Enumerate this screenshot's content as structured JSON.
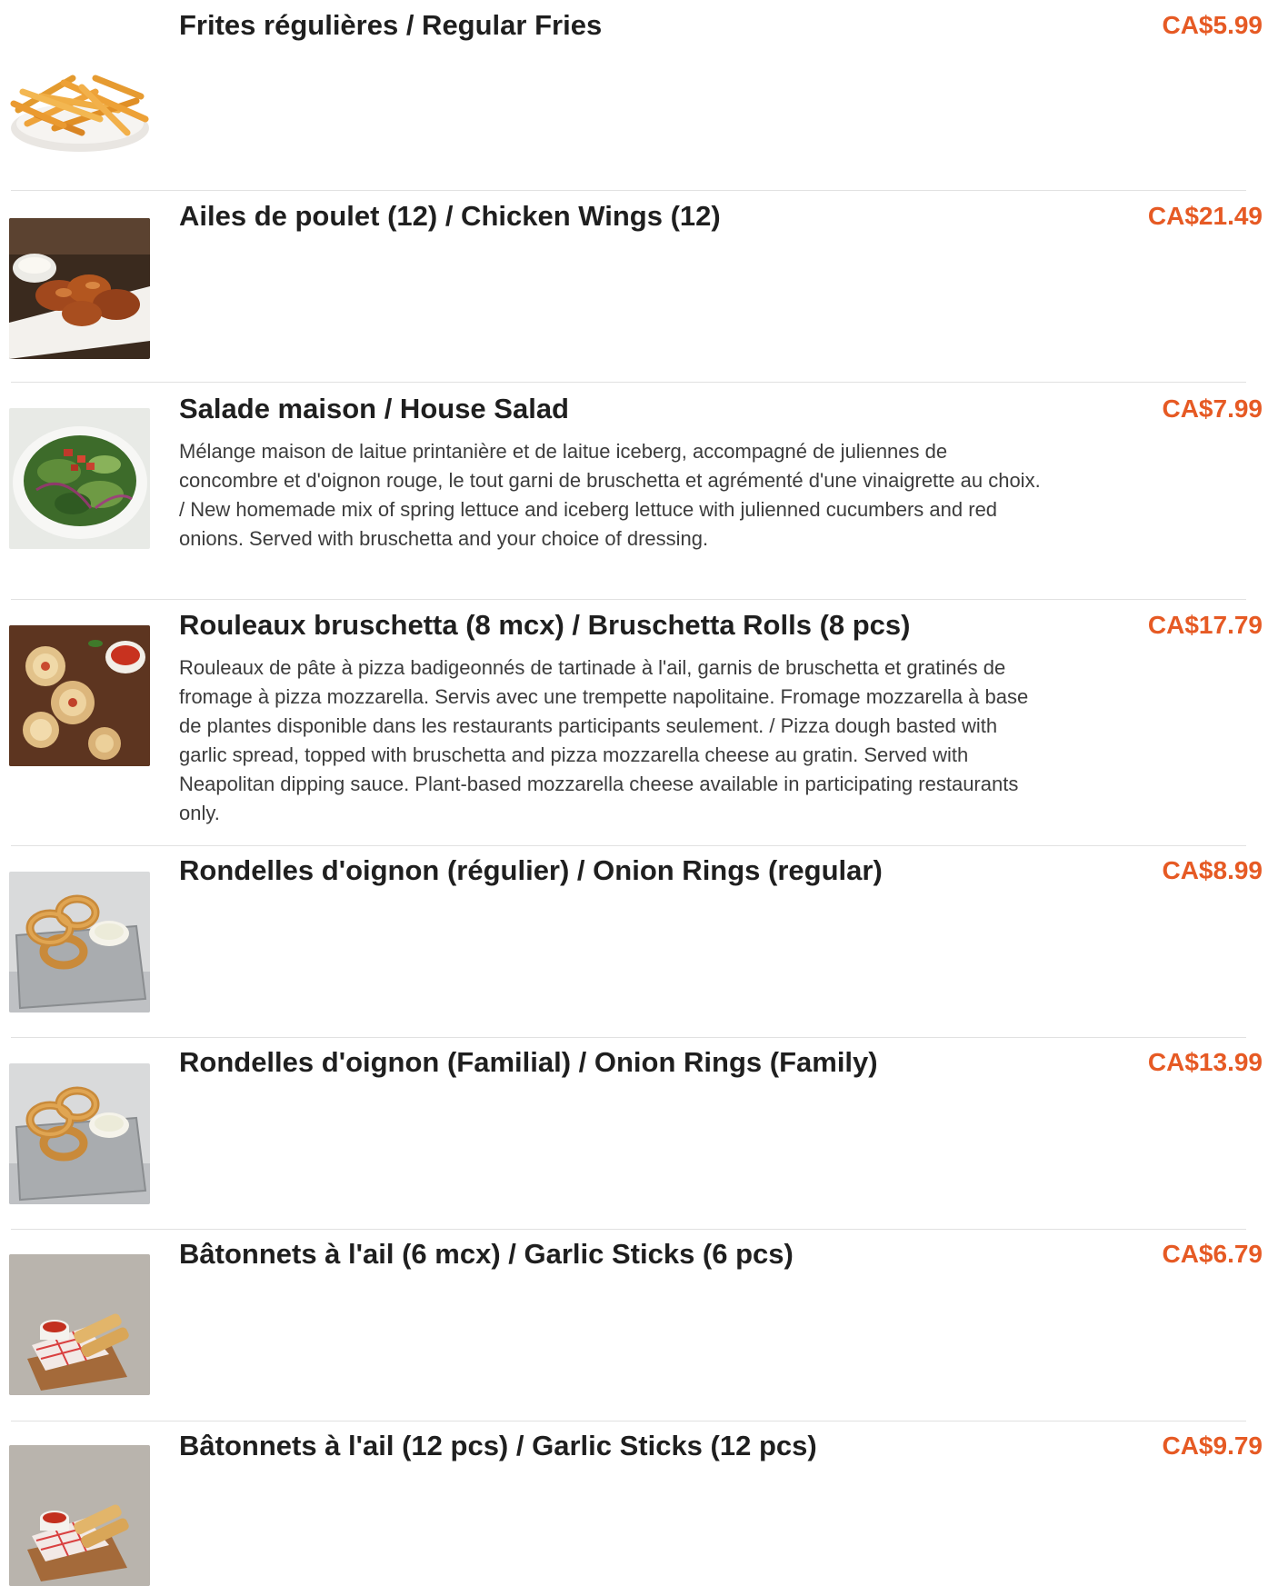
{
  "colors": {
    "price": "#e65a24",
    "title": "#1f1f1f",
    "description": "#3c3c3c",
    "divider": "#e1e1e1"
  },
  "items": [
    {
      "name": "Frites régulières / Regular Fries",
      "price": "CA$5.99",
      "description": "",
      "image": "fries-photo"
    },
    {
      "name": "Ailes de poulet (12) / Chicken Wings (12)",
      "price": "CA$21.49",
      "description": "",
      "image": "chicken-wings-photo"
    },
    {
      "name": "Salade maison / House Salad",
      "price": "CA$7.99",
      "description": "Mélange maison de laitue printanière et de laitue iceberg, accompagné de juliennes de concombre et d'oignon rouge, le tout garni de bruschetta et agrémenté d'une vinaigrette au choix. / New homemade mix of spring lettuce and iceberg lettuce with julienned cucumbers and red onions. Served with bruschetta and your choice of dressing.",
      "image": "house-salad-photo"
    },
    {
      "name": "Rouleaux bruschetta (8 mcx) / Bruschetta Rolls (8 pcs)",
      "price": "CA$17.79",
      "description": "Rouleaux de pâte à pizza badigeonnés de tartinade à l'ail, garnis de bruschetta et gratinés de fromage à pizza mozzarella. Servis avec une trempette napolitaine. Fromage mozzarella à base de plantes disponible dans les restaurants participants seulement. / Pizza dough basted with garlic spread, topped with bruschetta and pizza mozzarella cheese au gratin. Served with Neapolitan dipping sauce. Plant-based mozzarella cheese available in participating restaurants only.",
      "image": "bruschetta-rolls-photo"
    },
    {
      "name": "Rondelles d'oignon (régulier) / Onion Rings (regular)",
      "price": "CA$8.99",
      "description": "",
      "image": "onion-rings-photo"
    },
    {
      "name": "Rondelles d'oignon (Familial) / Onion Rings (Family)",
      "price": "CA$13.99",
      "description": "",
      "image": "onion-rings-photo"
    },
    {
      "name": "Bâtonnets à l'ail (6 mcx) / Garlic Sticks (6 pcs)",
      "price": "CA$6.79",
      "description": "",
      "image": "garlic-sticks-photo"
    },
    {
      "name": "Bâtonnets à l'ail (12 pcs) / Garlic Sticks (12 pcs)",
      "price": "CA$9.79",
      "description": "",
      "image": "garlic-sticks-photo"
    }
  ]
}
